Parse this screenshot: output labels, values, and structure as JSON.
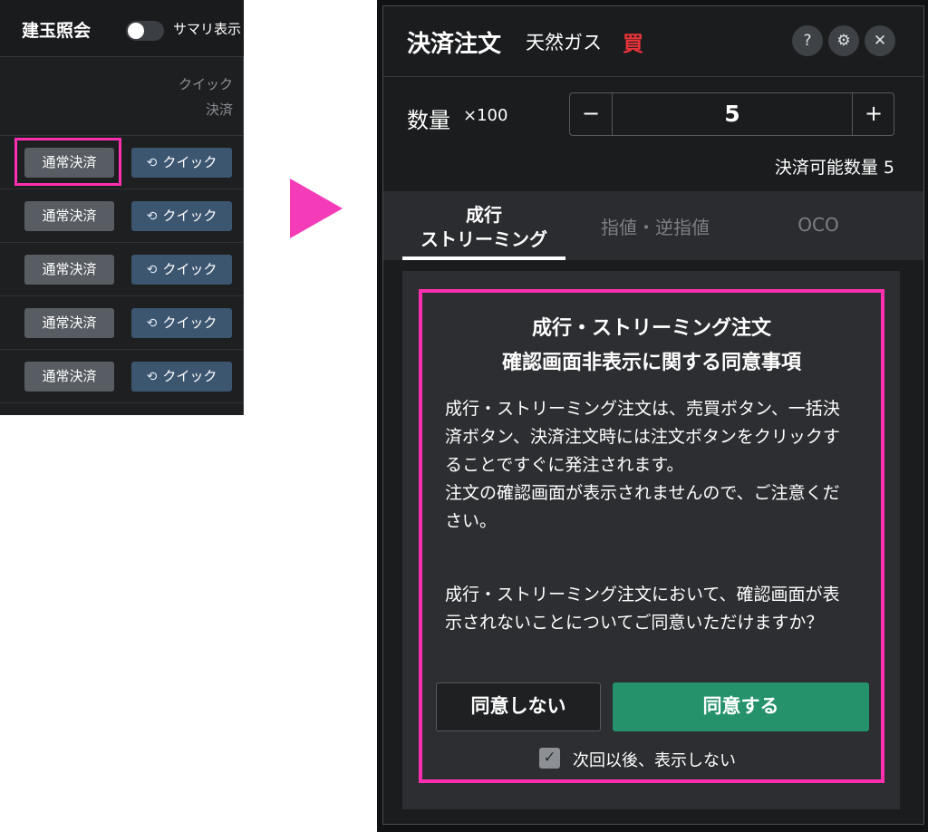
{
  "left": {
    "title": "建玉照会",
    "summary_label": "サマリ表示",
    "column_header": [
      "クイック",
      "決済"
    ],
    "rows": [
      {
        "normal_label": "通常決済",
        "quick_label": "クイック"
      },
      {
        "normal_label": "通常決済",
        "quick_label": "クイック"
      },
      {
        "normal_label": "通常決済",
        "quick_label": "クイック"
      },
      {
        "normal_label": "通常決済",
        "quick_label": "クイック"
      },
      {
        "normal_label": "通常決済",
        "quick_label": "クイック"
      }
    ],
    "quick_icon": "refresh-icon",
    "highlight_color": "#ff2fb0"
  },
  "arrow_color": "#f43cb8",
  "dialog": {
    "title": "決済注文",
    "product": "天然ガス",
    "side": "買",
    "side_color": "#e8333a",
    "header_icons": [
      "help-icon",
      "gear-icon",
      "close-icon"
    ],
    "help_symbol": "?",
    "gear_symbol": "⚙",
    "close_symbol": "✕",
    "quantity": {
      "label": "数量",
      "unit": "×100",
      "minus": "−",
      "value": "5",
      "plus": "+",
      "available": "決済可能数量 5"
    },
    "tabs": [
      {
        "label_line1": "成行",
        "label_line2": "ストリーミング",
        "active": true
      },
      {
        "label": "指値・逆指値",
        "active": false
      },
      {
        "label": "OCO",
        "active": false
      }
    ],
    "consent": {
      "title_line1": "成行・ストリーミング注文",
      "title_line2": "確認画面非表示に関する同意事項",
      "paragraph1": "成行・ストリーミング注文は、売買ボタン、一括決済ボタン、決済注文時には注文ボタンをクリックすることですぐに発注されます。\n注文の確認画面が表示されませんので、ご注意ください。",
      "paragraph2": "成行・ストリーミング注文において、確認画面が表示されないことについてご同意いただけますか？",
      "decline_label": "同意しない",
      "agree_label": "同意する",
      "agree_color": "#25926c",
      "checkbox_checked": true,
      "checkbox_label": "次回以後、表示しない"
    }
  }
}
